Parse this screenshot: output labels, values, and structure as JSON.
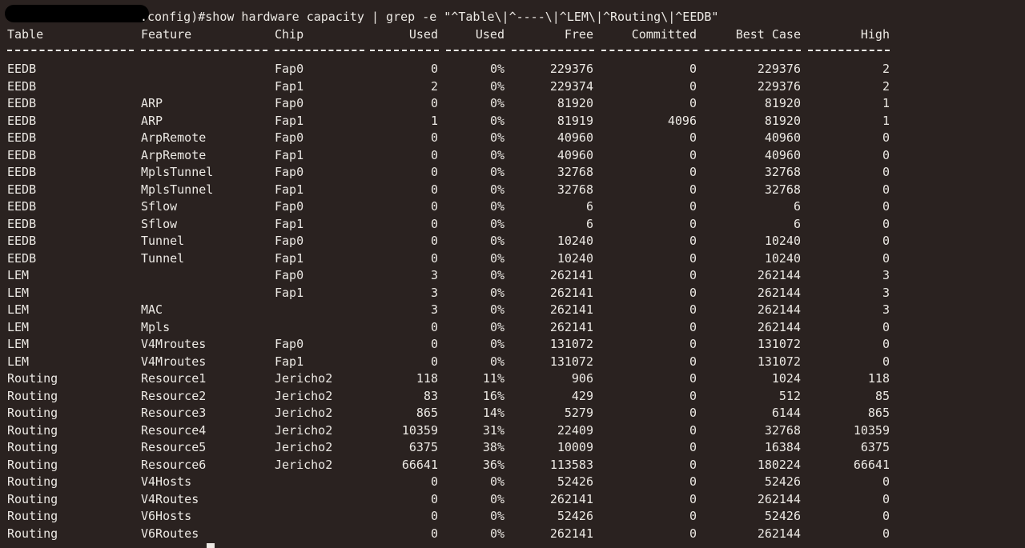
{
  "terminal": {
    "command": ".config)#show hardware capacity | grep -e \"^Table\\|^----\\|^LEM\\|^Routing\\|^EEDB\"",
    "prompt_tail": "...   ... 5 ...(config)#"
  },
  "table": {
    "headers": [
      "Table",
      "Feature",
      "Chip",
      "Used",
      "Used",
      "Free",
      "Committed",
      "Best Case",
      "High"
    ],
    "rows": [
      [
        "EEDB",
        "",
        "Fap0",
        "0",
        "0%",
        "229376",
        "0",
        "229376",
        "2"
      ],
      [
        "EEDB",
        "",
        "Fap1",
        "2",
        "0%",
        "229374",
        "0",
        "229376",
        "2"
      ],
      [
        "EEDB",
        "ARP",
        "Fap0",
        "0",
        "0%",
        "81920",
        "0",
        "81920",
        "1"
      ],
      [
        "EEDB",
        "ARP",
        "Fap1",
        "1",
        "0%",
        "81919",
        "4096",
        "81920",
        "1"
      ],
      [
        "EEDB",
        "ArpRemote",
        "Fap0",
        "0",
        "0%",
        "40960",
        "0",
        "40960",
        "0"
      ],
      [
        "EEDB",
        "ArpRemote",
        "Fap1",
        "0",
        "0%",
        "40960",
        "0",
        "40960",
        "0"
      ],
      [
        "EEDB",
        "MplsTunnel",
        "Fap0",
        "0",
        "0%",
        "32768",
        "0",
        "32768",
        "0"
      ],
      [
        "EEDB",
        "MplsTunnel",
        "Fap1",
        "0",
        "0%",
        "32768",
        "0",
        "32768",
        "0"
      ],
      [
        "EEDB",
        "Sflow",
        "Fap0",
        "0",
        "0%",
        "6",
        "0",
        "6",
        "0"
      ],
      [
        "EEDB",
        "Sflow",
        "Fap1",
        "0",
        "0%",
        "6",
        "0",
        "6",
        "0"
      ],
      [
        "EEDB",
        "Tunnel",
        "Fap0",
        "0",
        "0%",
        "10240",
        "0",
        "10240",
        "0"
      ],
      [
        "EEDB",
        "Tunnel",
        "Fap1",
        "0",
        "0%",
        "10240",
        "0",
        "10240",
        "0"
      ],
      [
        "LEM",
        "",
        "Fap0",
        "3",
        "0%",
        "262141",
        "0",
        "262144",
        "3"
      ],
      [
        "LEM",
        "",
        "Fap1",
        "3",
        "0%",
        "262141",
        "0",
        "262144",
        "3"
      ],
      [
        "LEM",
        "MAC",
        "",
        "3",
        "0%",
        "262141",
        "0",
        "262144",
        "3"
      ],
      [
        "LEM",
        "Mpls",
        "",
        "0",
        "0%",
        "262141",
        "0",
        "262144",
        "0"
      ],
      [
        "LEM",
        "V4Mroutes",
        "Fap0",
        "0",
        "0%",
        "131072",
        "0",
        "131072",
        "0"
      ],
      [
        "LEM",
        "V4Mroutes",
        "Fap1",
        "0",
        "0%",
        "131072",
        "0",
        "131072",
        "0"
      ],
      [
        "Routing",
        "Resource1",
        "Jericho2",
        "118",
        "11%",
        "906",
        "0",
        "1024",
        "118"
      ],
      [
        "Routing",
        "Resource2",
        "Jericho2",
        "83",
        "16%",
        "429",
        "0",
        "512",
        "85"
      ],
      [
        "Routing",
        "Resource3",
        "Jericho2",
        "865",
        "14%",
        "5279",
        "0",
        "6144",
        "865"
      ],
      [
        "Routing",
        "Resource4",
        "Jericho2",
        "10359",
        "31%",
        "22409",
        "0",
        "32768",
        "10359"
      ],
      [
        "Routing",
        "Resource5",
        "Jericho2",
        "6375",
        "38%",
        "10009",
        "0",
        "16384",
        "6375"
      ],
      [
        "Routing",
        "Resource6",
        "Jericho2",
        "66641",
        "36%",
        "113583",
        "0",
        "180224",
        "66641"
      ],
      [
        "Routing",
        "V4Hosts",
        "",
        "0",
        "0%",
        "52426",
        "0",
        "52426",
        "0"
      ],
      [
        "Routing",
        "V4Routes",
        "",
        "0",
        "0%",
        "262141",
        "0",
        "262144",
        "0"
      ],
      [
        "Routing",
        "V6Hosts",
        "",
        "0",
        "0%",
        "52426",
        "0",
        "52426",
        "0"
      ],
      [
        "Routing",
        "V6Routes",
        "",
        "0",
        "0%",
        "262141",
        "0",
        "262144",
        "0"
      ]
    ]
  },
  "colors": {
    "background": "#2a2220",
    "foreground": "#ece9e4",
    "redaction": "#000000"
  }
}
